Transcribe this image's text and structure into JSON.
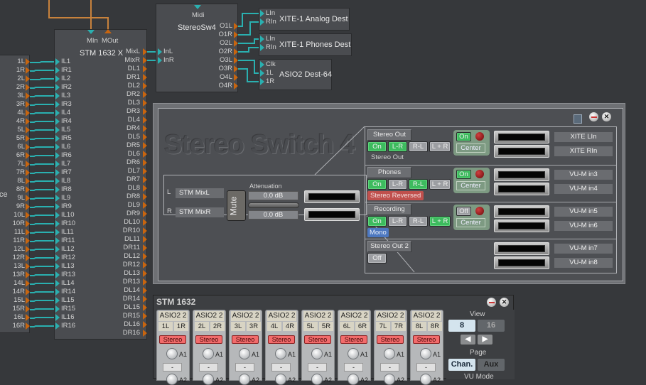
{
  "source_module": {
    "partial_label": "ce",
    "outputs": [
      "1L",
      "1R",
      "2L",
      "2R",
      "3L",
      "3R",
      "4L",
      "4R",
      "5L",
      "5R",
      "6L",
      "6R",
      "7L",
      "7R",
      "8L",
      "8R",
      "9L",
      "9R",
      "10L",
      "10R",
      "11L",
      "11R",
      "12L",
      "12R",
      "13L",
      "13R",
      "14L",
      "14R",
      "15L",
      "15R",
      "16L",
      "16R"
    ]
  },
  "stm_module": {
    "title": "STM 1632 X",
    "midi_in": "MIn",
    "midi_out": "MOut",
    "inputs": [
      "IL1",
      "IR1",
      "IL2",
      "IR2",
      "IL3",
      "IR3",
      "IL4",
      "IR4",
      "IL5",
      "IR5",
      "IL6",
      "IR6",
      "IL7",
      "IR7",
      "IL8",
      "IR8",
      "IL9",
      "IR9",
      "IL10",
      "IR10",
      "IL11",
      "IR11",
      "IL12",
      "IR12",
      "IL13",
      "IR13",
      "IL14",
      "IR14",
      "IL15",
      "IR15",
      "IL16",
      "IR16"
    ],
    "outputs": [
      "MixL",
      "MixR",
      "DL1",
      "DR1",
      "DL2",
      "DR2",
      "DL3",
      "DR3",
      "DL4",
      "DR4",
      "DL5",
      "DR5",
      "DL6",
      "DR6",
      "DL7",
      "DR7",
      "DL8",
      "DR8",
      "DL9",
      "DR9",
      "DL10",
      "DR10",
      "DL11",
      "DR11",
      "DL12",
      "DR12",
      "DL13",
      "DR13",
      "DL14",
      "DR14",
      "DL15",
      "DR15",
      "DL16",
      "DR16"
    ]
  },
  "sw_module": {
    "title": "StereoSw4",
    "midi": "Midi",
    "inputs": [
      "InL",
      "InR"
    ],
    "outputs": [
      "O1L",
      "O1R",
      "O2L",
      "O2R",
      "O3L",
      "O3R",
      "O4L",
      "O4R"
    ]
  },
  "dest_modules": [
    {
      "title": "XITE-1 Analog Dest",
      "inputs": [
        "LIn",
        "RIn"
      ]
    },
    {
      "title": "XITE-1 Phones Dest",
      "inputs": [
        "LIn",
        "RIn"
      ]
    },
    {
      "title": "ASIO2 Dest-64",
      "inputs": [
        "Clk",
        "1L",
        "1R"
      ]
    }
  ],
  "stereo_switch": {
    "title": "Stereo Switch 4",
    "input": {
      "channels": [
        {
          "side": "L",
          "source": "STM MixL",
          "attenuation": "0.0 dB"
        },
        {
          "side": "R",
          "source": "STM MixR",
          "attenuation": "0.0 dB"
        }
      ],
      "attenuation_label": "Attenuation",
      "mute_label": "Mute"
    },
    "outputs": [
      {
        "name": "Stereo Out",
        "modes": [
          {
            "label": "On",
            "active": true
          },
          {
            "label": "L-R",
            "active": true
          },
          {
            "label": "R-L",
            "active": false
          },
          {
            "label": "L + R",
            "active": false
          }
        ],
        "status": "Stereo Out",
        "status_style": "plain",
        "center_toggle": "On",
        "center_active": true,
        "center_label": "Center",
        "meters": [
          "XITE LIn",
          "XITE RIn"
        ]
      },
      {
        "name": "Phones",
        "modes": [
          {
            "label": "On",
            "active": true
          },
          {
            "label": "L-R",
            "active": false
          },
          {
            "label": "R-L",
            "active": true
          },
          {
            "label": "L + R",
            "active": false
          }
        ],
        "status": "Stereo Reversed",
        "status_style": "red",
        "center_toggle": "On",
        "center_active": true,
        "center_label": "Center",
        "meters": [
          "VU-M in3",
          "VU-M in4"
        ]
      },
      {
        "name": "Recording",
        "modes": [
          {
            "label": "On",
            "active": true
          },
          {
            "label": "L-R",
            "active": false
          },
          {
            "label": "R-L",
            "active": false
          },
          {
            "label": "L + R",
            "active": true
          }
        ],
        "status": "Mono",
        "status_style": "blue",
        "center_toggle": "Off",
        "center_active": false,
        "center_label": "Center",
        "meters": [
          "VU-M in5",
          "VU-M in6"
        ]
      },
      {
        "name": "Stereo Out 2",
        "modes": [
          {
            "label": "Off",
            "active": false
          }
        ],
        "status": "",
        "status_style": "plain",
        "meters": [
          "VU-M in7",
          "VU-M in8"
        ]
      }
    ]
  },
  "mixer": {
    "title": "STM 1632",
    "strips": [
      {
        "name": "ASIO2 2",
        "left": "1L",
        "right": "1R",
        "mode": "Stereo",
        "knob1": "A1",
        "value": "-",
        "knob2": "A2"
      },
      {
        "name": "ASIO2 2",
        "left": "2L",
        "right": "2R",
        "mode": "Stereo",
        "knob1": "A1",
        "value": "-",
        "knob2": "A2"
      },
      {
        "name": "ASIO2 2",
        "left": "3L",
        "right": "3R",
        "mode": "Stereo",
        "knob1": "A1",
        "value": "-",
        "knob2": "A2"
      },
      {
        "name": "ASIO2 2",
        "left": "4L",
        "right": "4R",
        "mode": "Stereo",
        "knob1": "A1",
        "value": "-",
        "knob2": "A2"
      },
      {
        "name": "ASIO2 2",
        "left": "5L",
        "right": "5R",
        "mode": "Stereo",
        "knob1": "A1",
        "value": "-",
        "knob2": "A2"
      },
      {
        "name": "ASIO2 2",
        "left": "6L",
        "right": "6R",
        "mode": "Stereo",
        "knob1": "A1",
        "value": "-",
        "knob2": "A2"
      },
      {
        "name": "ASIO2 2",
        "left": "7L",
        "right": "7R",
        "mode": "Stereo",
        "knob1": "A1",
        "value": "-",
        "knob2": "A2"
      },
      {
        "name": "ASIO2 2",
        "left": "8L",
        "right": "8R",
        "mode": "Stereo",
        "knob1": "A1",
        "value": "-",
        "knob2": "A2"
      }
    ],
    "view_label": "View",
    "view_options": [
      "8",
      "16"
    ],
    "view_selected": "8",
    "page_label": "Page",
    "page_options": [
      "Chan.",
      "Aux"
    ],
    "page_selected": "Chan.",
    "vu_mode_label": "VU Mode"
  },
  "colors": {
    "wire_audio": "#2ab0b0",
    "wire_midi": "#c8823c",
    "port_out": "#c8650f",
    "button_on": "#3dbb5e",
    "status_red": "#c0504d",
    "status_blue": "#4d78c0",
    "stereo_btn": "#f26b6b"
  }
}
